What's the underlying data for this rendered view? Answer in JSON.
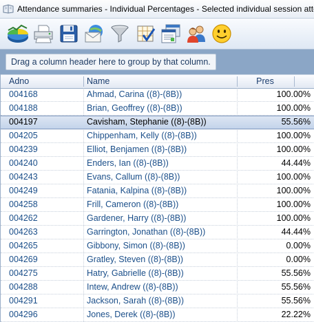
{
  "window": {
    "title": "Attendance summaries - Individual Percentages - Selected individual session atte"
  },
  "toolbar": {
    "buttons": [
      {
        "name": "chart-icon"
      },
      {
        "name": "printer-icon"
      },
      {
        "name": "save-icon"
      },
      {
        "name": "email-icon"
      },
      {
        "name": "filter-icon"
      },
      {
        "name": "checklist-icon"
      },
      {
        "name": "report-icon"
      },
      {
        "name": "users-icon"
      },
      {
        "name": "smiley-icon"
      }
    ]
  },
  "group_panel": {
    "hint": "Drag a column header here to group by that column."
  },
  "grid": {
    "columns": [
      "Adno",
      "Name",
      "Pres"
    ],
    "selected_index": 2,
    "rows": [
      {
        "adno": "004168",
        "name": "Ahmad, Carina ((8)-(8B))",
        "pres": "100.00%"
      },
      {
        "adno": "004188",
        "name": "Brian, Geoffrey ((8)-(8B))",
        "pres": "100.00%"
      },
      {
        "adno": "004197",
        "name": "Cavisham, Stephanie ((8)-(8B))",
        "pres": "55.56%"
      },
      {
        "adno": "004205",
        "name": "Chippenham, Kelly ((8)-(8B))",
        "pres": "100.00%"
      },
      {
        "adno": "004239",
        "name": "Elliot, Benjamen ((8)-(8B))",
        "pres": "100.00%"
      },
      {
        "adno": "004240",
        "name": "Enders, Ian ((8)-(8B))",
        "pres": "44.44%"
      },
      {
        "adno": "004243",
        "name": "Evans, Callum ((8)-(8B))",
        "pres": "100.00%"
      },
      {
        "adno": "004249",
        "name": "Fatania, Kalpina ((8)-(8B))",
        "pres": "100.00%"
      },
      {
        "adno": "004258",
        "name": "Frill, Cameron ((8)-(8B))",
        "pres": "100.00%"
      },
      {
        "adno": "004262",
        "name": "Gardener, Harry ((8)-(8B))",
        "pres": "100.00%"
      },
      {
        "adno": "004263",
        "name": "Garrington, Jonathan ((8)-(8B))",
        "pres": "44.44%"
      },
      {
        "adno": "004265",
        "name": "Gibbony, Simon ((8)-(8B))",
        "pres": "0.00%"
      },
      {
        "adno": "004269",
        "name": "Gratley, Steven ((8)-(8B))",
        "pres": "0.00%"
      },
      {
        "adno": "004275",
        "name": "Hatry, Gabrielle ((8)-(8B))",
        "pres": "55.56%"
      },
      {
        "adno": "004288",
        "name": "Intew, Andrew ((8)-(8B))",
        "pres": "55.56%"
      },
      {
        "adno": "004291",
        "name": "Jackson, Sarah ((8)-(8B))",
        "pres": "55.56%"
      },
      {
        "adno": "004296",
        "name": "Jones, Derek ((8)-(8B))",
        "pres": "22.22%"
      }
    ]
  }
}
